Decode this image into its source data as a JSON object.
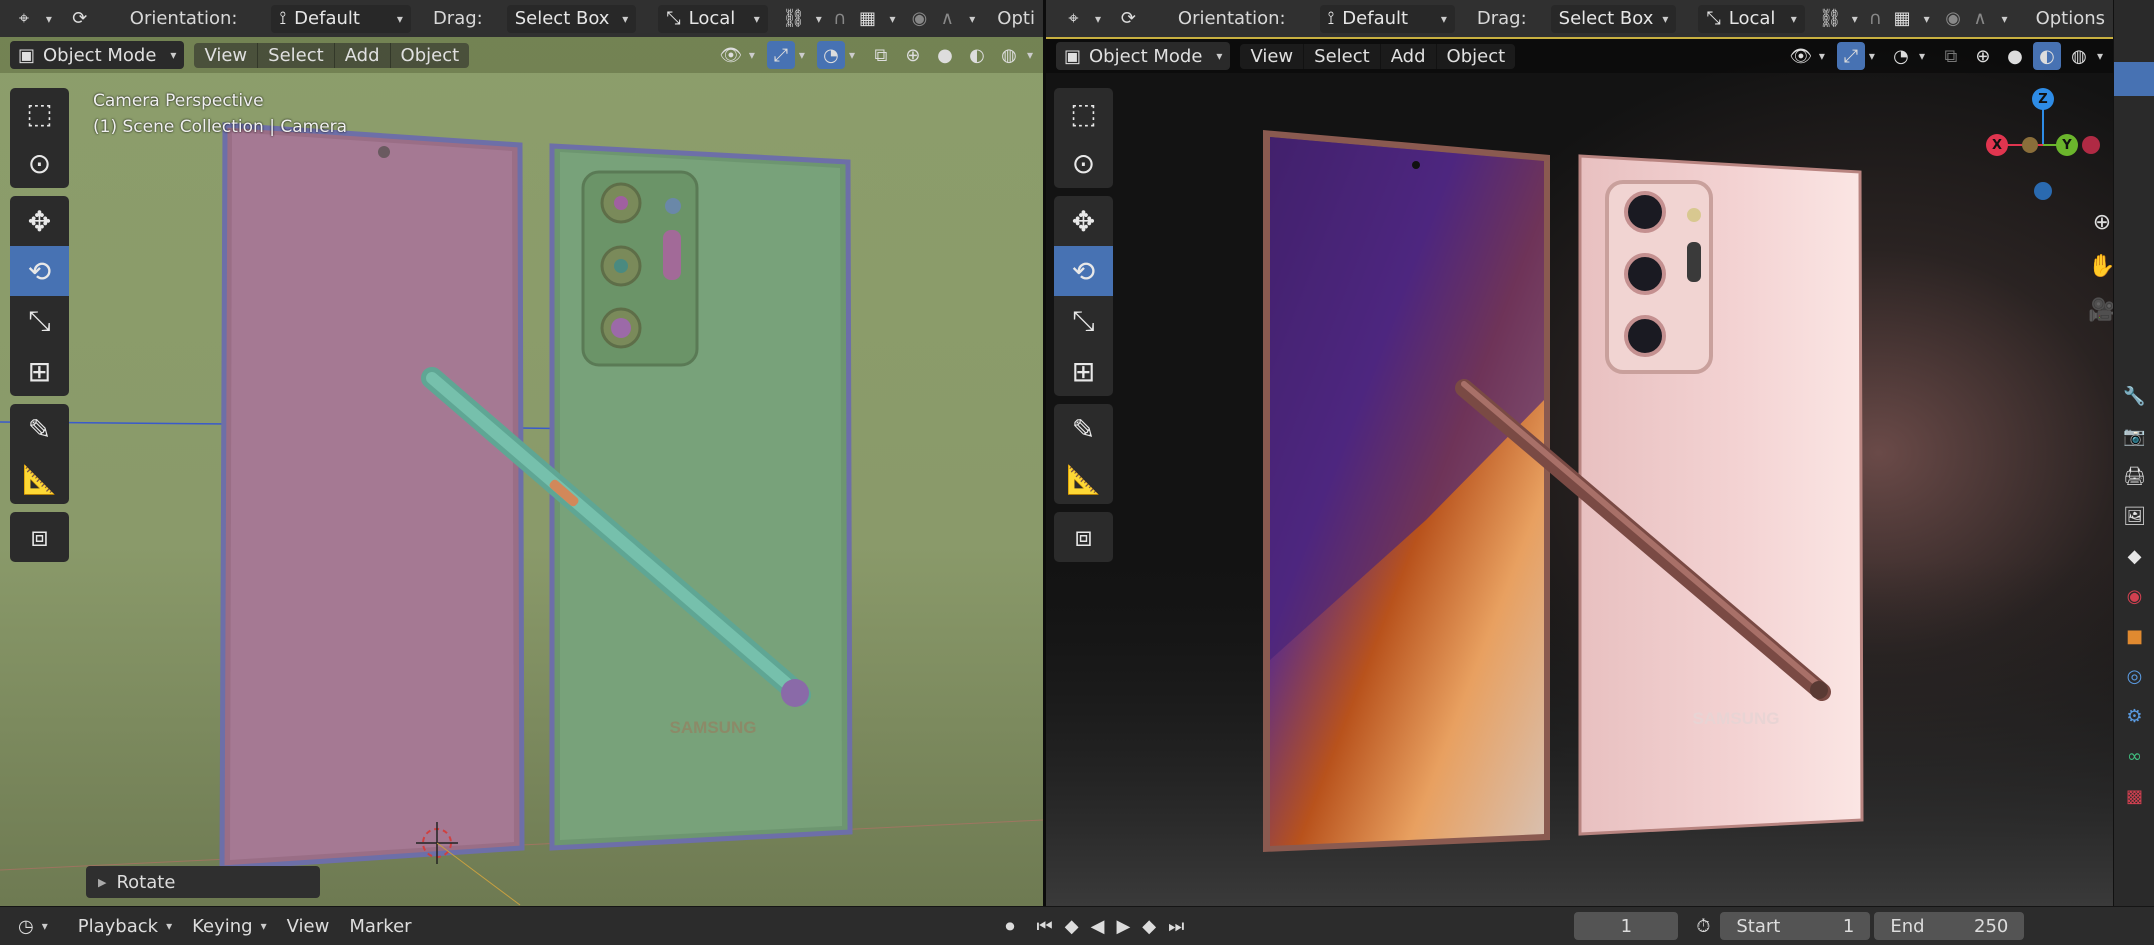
{
  "left_viewport": {
    "header": {
      "orientation_label": "Orientation:",
      "orientation_value": "Default",
      "drag_label": "Drag:",
      "drag_value": "Select Box",
      "pivot_value": "Local",
      "options_label": "Opti"
    },
    "mode": "Object Mode",
    "menus": [
      "View",
      "Select",
      "Add",
      "Object"
    ],
    "overlay_text_1": "Camera Perspective",
    "overlay_text_2": "(1) Scene Collection | Camera",
    "last_operator": "Rotate",
    "brand_text": "SAMSUNG"
  },
  "right_viewport": {
    "header": {
      "orientation_label": "Orientation:",
      "orientation_value": "Default",
      "drag_label": "Drag:",
      "drag_value": "Select Box",
      "pivot_value": "Local",
      "options_label": "Options"
    },
    "mode": "Object Mode",
    "menus": [
      "View",
      "Select",
      "Add",
      "Object"
    ],
    "gizmo": {
      "x": "X",
      "y": "Y",
      "z": "Z"
    },
    "brand_text": "SAMSUNG"
  },
  "timeline": {
    "menus": [
      "Playback",
      "Keying",
      "View",
      "Marker"
    ],
    "current_frame": "1",
    "start_label": "Start",
    "start_value": "1",
    "end_label": "End",
    "end_value": "250"
  },
  "colors": {
    "accent": "#4772b3",
    "header_bg": "#303030",
    "solid_viewport_bg": "#8a9a6a"
  }
}
